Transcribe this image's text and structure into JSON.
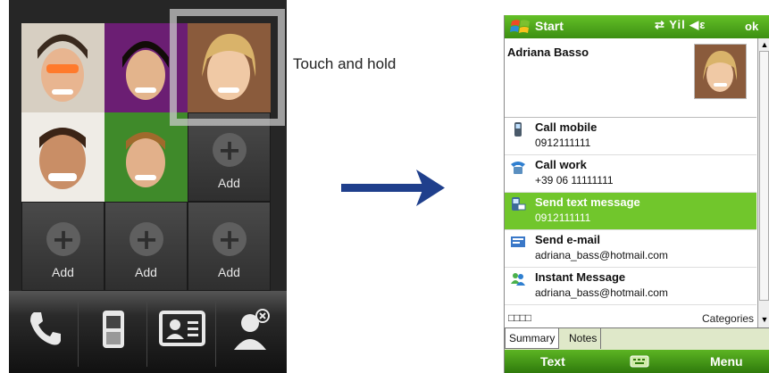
{
  "left_phone": {
    "add_tiles": [
      {
        "label": "Add"
      },
      {
        "label": "Add"
      },
      {
        "label": "Add"
      },
      {
        "label": "Add"
      }
    ],
    "bottom_bar": [
      {
        "icon": "phone-icon"
      },
      {
        "icon": "mobile-phone-icon"
      },
      {
        "icon": "contact-card-icon"
      },
      {
        "icon": "remove-person-icon"
      }
    ]
  },
  "annotation": {
    "touch_label": "Touch and hold"
  },
  "right_phone": {
    "title_bar": {
      "title": "Start",
      "status_icons": "⇄ Yil ◀ε",
      "ok_label": "ok"
    },
    "contact": {
      "name": "Adriana Basso"
    },
    "actions": [
      {
        "title": "Call mobile",
        "value": "0912111111",
        "icon": "mobile-phone-icon"
      },
      {
        "title": "Call work",
        "value": "+39 06 11111111",
        "icon": "work-phone-icon"
      },
      {
        "title": "Send text message",
        "value": "0912111111",
        "icon": "sms-icon",
        "selected": true
      },
      {
        "title": "Send e-mail",
        "value": "adriana_bass@hotmail.com",
        "icon": "email-icon"
      },
      {
        "title": "Instant Message",
        "value": "adriana_bass@hotmail.com",
        "icon": "messenger-icon"
      }
    ],
    "check_boxes": "□□□□",
    "categories_label": "Categories",
    "tabs": [
      {
        "label": "Summary",
        "active": true
      },
      {
        "label": "Notes",
        "active": false
      }
    ],
    "soft_keys": {
      "left": "Text",
      "right": "Menu"
    },
    "colors": {
      "accent_green": "#71c62c",
      "bar_green": "#3c8f12",
      "arrow_blue": "#1f3f8c"
    }
  }
}
